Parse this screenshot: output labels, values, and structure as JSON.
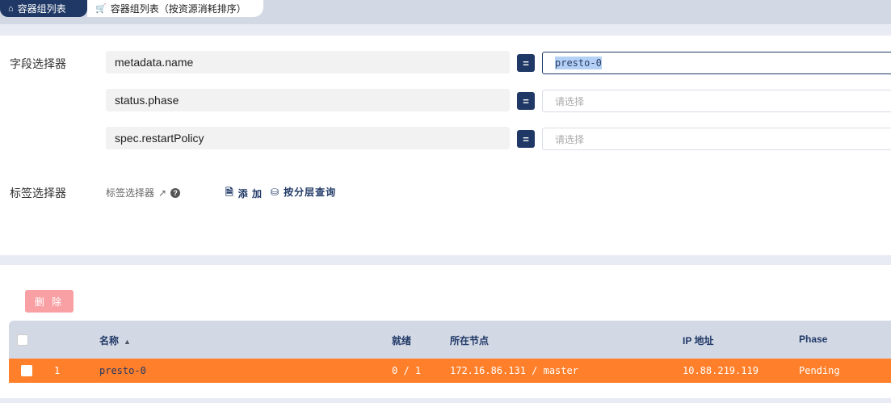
{
  "tabs": [
    {
      "label": "容器组列表",
      "icon": "home-icon",
      "active": true
    },
    {
      "label": "容器组列表（按资源消耗排序）",
      "icon": "cart-icon",
      "active": false
    }
  ],
  "filter": {
    "field_selector_label": "字段选择器",
    "fields": [
      {
        "key": "metadata.name",
        "op": "=",
        "value": "presto-0",
        "placeholder": ""
      },
      {
        "key": "status.phase",
        "op": "=",
        "value": "",
        "placeholder": "请选择"
      },
      {
        "key": "spec.restartPolicy",
        "op": "=",
        "value": "",
        "placeholder": "请选择"
      }
    ],
    "label_selector_label": "标签选择器",
    "label_selector_sub": "标签选择器",
    "add_label": "添 加",
    "layer_query_label": "按分层查询"
  },
  "list": {
    "delete_label": "删 除",
    "columns": [
      "名称",
      "就绪",
      "所在节点",
      "IP 地址",
      "Phase"
    ],
    "rows": [
      {
        "index": "1",
        "name": "presto-0",
        "ready": "0 / 1",
        "node": "172.16.86.131 / master",
        "ip": "10.88.219.119",
        "phase": "Pending"
      }
    ]
  },
  "colors": {
    "primary": "#1f3866",
    "row_highlight": "#ff7f2a",
    "danger_disabled": "#f8a0a4"
  }
}
